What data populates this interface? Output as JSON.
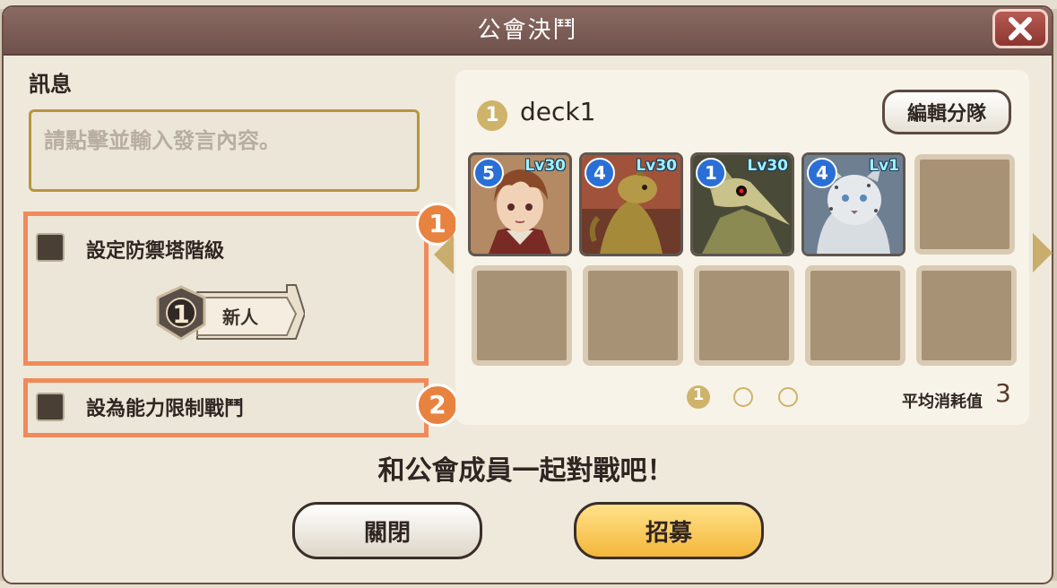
{
  "dialog": {
    "title": "公會決鬥",
    "close_icon": "close-x-icon"
  },
  "message": {
    "label": "訊息",
    "placeholder": "請點擊並輸入發言內容。"
  },
  "options": {
    "tower_rank": {
      "label": "設定防禦塔階級",
      "checked": false,
      "rank_number": "1",
      "rank_name": "新人"
    },
    "ability_limit": {
      "label": "設為能力限制戰鬥",
      "checked": false
    }
  },
  "markers": [
    "1",
    "2"
  ],
  "deck": {
    "number": "1",
    "name": "deck1",
    "edit_label": "編輯分隊",
    "cards": [
      {
        "cost": "5",
        "level": "Lv30",
        "subject": "young-man-portrait"
      },
      {
        "cost": "4",
        "level": "Lv30",
        "subject": "lizard-creature"
      },
      {
        "cost": "1",
        "level": "Lv30",
        "subject": "bird-skull-creature"
      },
      {
        "cost": "4",
        "level": "Lv1",
        "subject": "snow-leopard"
      }
    ],
    "empty_slots": 6,
    "pages": [
      "1",
      "",
      ""
    ],
    "active_page": 1,
    "avg_cost_label": "平均消耗值",
    "avg_cost_value": "3"
  },
  "footer": {
    "text": "和公會成員一起對戰吧！",
    "close_button": "關閉",
    "recruit_button": "招募"
  },
  "colors": {
    "title_bar": "#7b5d56",
    "highlight": "#f08a5a",
    "recruit": "#f4b63a",
    "cost_badge": "#2a6fd6"
  }
}
